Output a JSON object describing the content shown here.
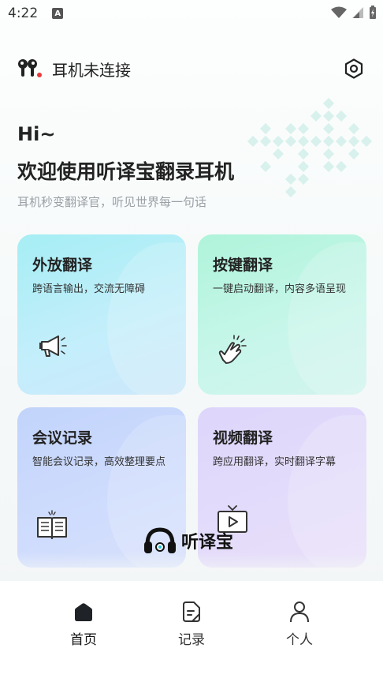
{
  "status_bar": {
    "time": "4:22",
    "notif_letter": "A"
  },
  "header": {
    "connection_status": "耳机未连接"
  },
  "greeting": {
    "hi": "Hi~",
    "welcome": "欢迎使用听译宝翻录耳机",
    "subtitle": "耳机秒变翻译官，听见世界每一句话"
  },
  "cards": [
    {
      "title": "外放翻译",
      "desc": "跨语言输出，交流无障碍",
      "icon": "megaphone-icon",
      "color": "#a6eef4"
    },
    {
      "title": "按键翻译",
      "desc": "一键启动翻译，内容多语呈现",
      "icon": "tap-hand-icon",
      "color": "#aff4da"
    },
    {
      "title": "会议记录",
      "desc": "智能会议记录，高效整理要点",
      "icon": "book-icon",
      "color": "#c2d4fb"
    },
    {
      "title": "视频翻译",
      "desc": "跨应用翻译，实时翻译字幕",
      "icon": "tv-play-icon",
      "color": "#ddd6fb"
    }
  ],
  "watermark": {
    "text": "听译宝"
  },
  "tabs": [
    {
      "label": "首页",
      "icon": "home-icon",
      "active": true
    },
    {
      "label": "记录",
      "icon": "document-icon",
      "active": false
    },
    {
      "label": "个人",
      "icon": "person-icon",
      "active": false
    }
  ]
}
